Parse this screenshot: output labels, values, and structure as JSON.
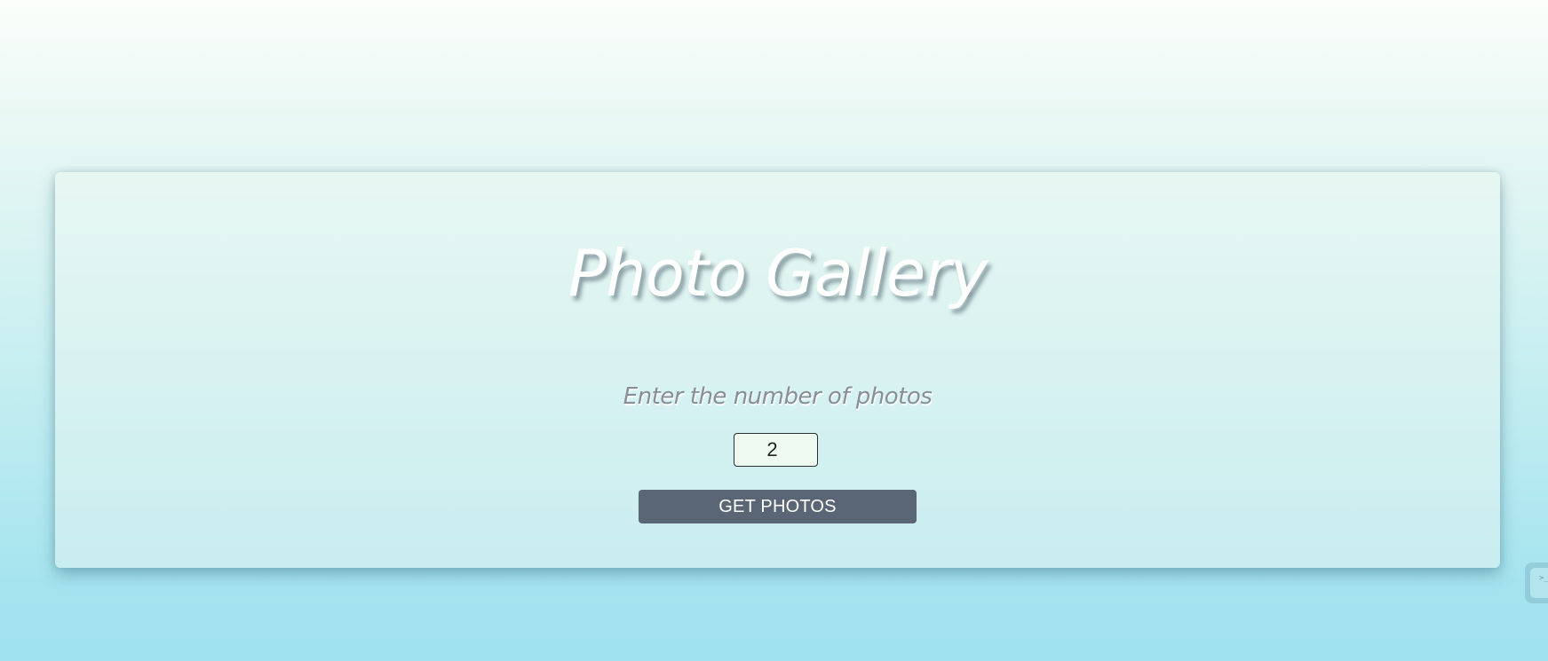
{
  "card": {
    "title": "Photo Gallery",
    "prompt": "Enter the number of photos",
    "count_input": {
      "value": "2"
    },
    "button_label": "GET PHOTOS"
  },
  "side_widget": {
    "icon": "terminal-icon",
    "glyph": ">_"
  },
  "colors": {
    "background_top": "#fbfefb",
    "background_bottom": "#a0e2ef",
    "card_top": "#e7f7f2",
    "card_bottom": "#c9edf0",
    "button_bg": "#5a6675",
    "button_text": "#ffffff",
    "title_text": "#ffffff",
    "prompt_text": "#888f96",
    "input_bg": "#eef9f0"
  }
}
